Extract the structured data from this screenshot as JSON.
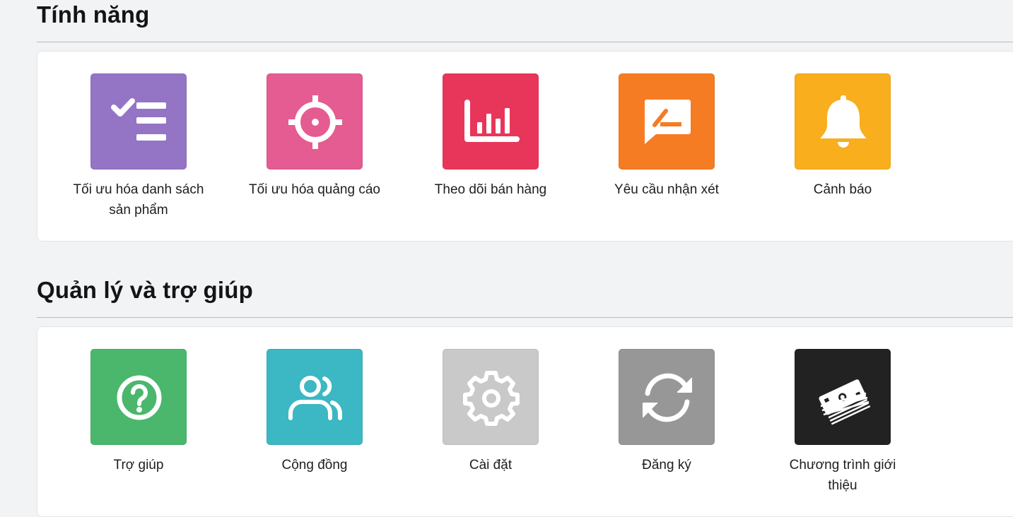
{
  "sections": [
    {
      "title": "Tính năng",
      "items": [
        {
          "label": "Tối ưu hóa danh sách sản phẩm",
          "icon": "checklist-icon",
          "color": "#9474c4"
        },
        {
          "label": "Tối ưu hóa quảng cáo",
          "icon": "crosshair-target-icon",
          "color": "#e45c91"
        },
        {
          "label": "Theo dõi bán hàng",
          "icon": "bar-chart-icon",
          "color": "#e8365a"
        },
        {
          "label": "Yêu cầu nhận xét",
          "icon": "review-chat-icon",
          "color": "#f57c23"
        },
        {
          "label": "Cảnh báo",
          "icon": "bell-icon",
          "color": "#f8ae1d"
        }
      ]
    },
    {
      "title": "Quản lý và trợ giúp",
      "items": [
        {
          "label": "Trợ giúp",
          "icon": "question-circle-icon",
          "color": "#4ab76c"
        },
        {
          "label": "Cộng đồng",
          "icon": "users-icon",
          "color": "#3cb7c4"
        },
        {
          "label": "Cài đặt",
          "icon": "gear-icon",
          "color": "#c9c9c9"
        },
        {
          "label": "Đăng ký",
          "icon": "refresh-icon",
          "color": "#979797"
        },
        {
          "label": "Chương trình giới thiệu",
          "icon": "money-stack-icon",
          "color": "#222222"
        }
      ]
    }
  ]
}
